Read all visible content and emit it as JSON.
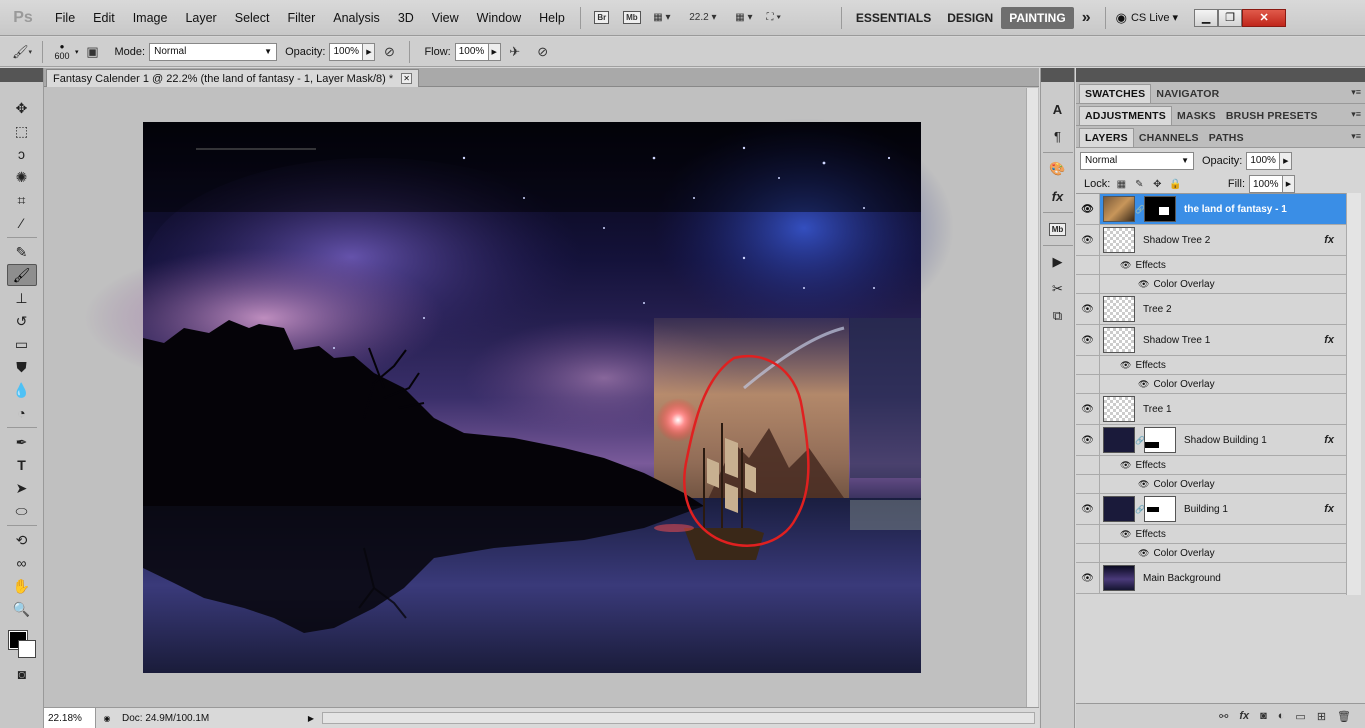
{
  "menubar": {
    "logo": "Ps",
    "items": [
      "File",
      "Edit",
      "Image",
      "Layer",
      "Select",
      "Filter",
      "Analysis",
      "3D",
      "View",
      "Window",
      "Help"
    ],
    "bridge_label": "Br",
    "minibridge_label": "Mb",
    "zoom_value": "22.2",
    "workspaces": [
      "ESSENTIALS",
      "DESIGN",
      "PAINTING"
    ],
    "active_workspace": "PAINTING",
    "more_label": "»",
    "cs_live": "CS Live"
  },
  "options": {
    "brush_size": "600",
    "mode_label": "Mode:",
    "mode_value": "Normal",
    "opacity_label": "Opacity:",
    "opacity_value": "100%",
    "flow_label": "Flow:",
    "flow_value": "100%"
  },
  "document": {
    "tab_title": "Fantasy Calender 1 @ 22.2% (the land of fantasy - 1, Layer Mask/8) *",
    "zoom": "22.18%",
    "doc_size": "Doc: 24.9M/100.1M"
  },
  "panels": {
    "group1_tabs": [
      "SWATCHES",
      "NAVIGATOR"
    ],
    "group2_tabs": [
      "ADJUSTMENTS",
      "MASKS",
      "BRUSH PRESETS"
    ],
    "group3_tabs": [
      "LAYERS",
      "CHANNELS",
      "PATHS"
    ]
  },
  "layers_panel": {
    "blend_mode": "Normal",
    "opacity_label": "Opacity:",
    "opacity_value": "100%",
    "lock_label": "Lock:",
    "fill_label": "Fill:",
    "fill_value": "100%",
    "effects_label": "Effects",
    "color_overlay_label": "Color Overlay",
    "layers": [
      {
        "name": "the land of fantasy - 1",
        "selected": true
      },
      {
        "name": "Shadow Tree 2",
        "fx": true
      },
      {
        "name": "Tree 2"
      },
      {
        "name": "Shadow Tree 1",
        "fx": true
      },
      {
        "name": "Tree 1"
      },
      {
        "name": "Shadow Building 1",
        "fx": true
      },
      {
        "name": "Building 1",
        "fx": true
      },
      {
        "name": "Main Background"
      }
    ]
  },
  "colors": {
    "selection_blue": "#3a8ee6",
    "annotation_red": "#e02020",
    "close_red": "#c0261b"
  }
}
